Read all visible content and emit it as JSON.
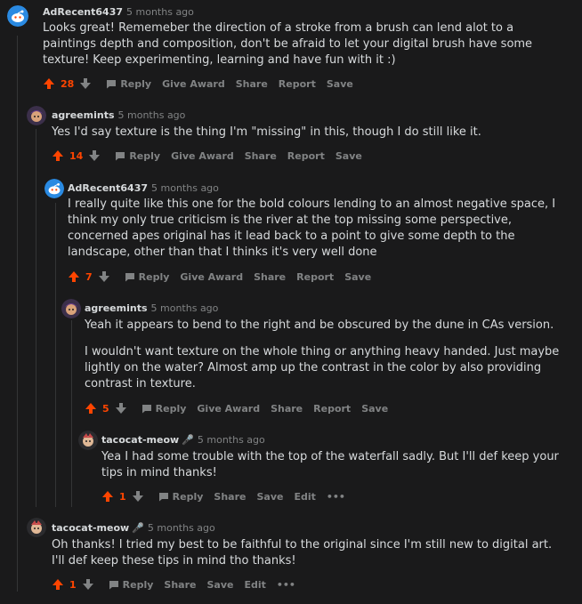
{
  "comments": [
    {
      "author": "AdRecent6437",
      "time": "5 months ago",
      "body": [
        "Looks great! Rememeber the direction of a stroke from a brush can lend alot to a paintings depth and composition, don't be afraid to let your digital brush have some texture! Keep experimenting, learning and have fun with it :)"
      ],
      "score": "28",
      "actions": [
        "Reply",
        "Give Award",
        "Share",
        "Report",
        "Save"
      ]
    },
    {
      "author": "agreemints",
      "time": "5 months ago",
      "body": [
        "Yes I'd say texture is the thing I'm \"missing\" in this, though I do still like it."
      ],
      "score": "14",
      "actions": [
        "Reply",
        "Give Award",
        "Share",
        "Report",
        "Save"
      ]
    },
    {
      "author": "AdRecent6437",
      "time": "5 months ago",
      "body": [
        "I really quite like this one for the bold colours lending to an almost negative space, I think my only true criticism is the river at the top missing some perspective, concerned apes original has it lead back to a point to give some depth to the landscape, other than that I thinks it's very well done"
      ],
      "score": "7",
      "actions": [
        "Reply",
        "Give Award",
        "Share",
        "Report",
        "Save"
      ]
    },
    {
      "author": "agreemints",
      "time": "5 months ago",
      "body": [
        "Yeah it appears to bend to the right and be obscured by the dune in CAs version.",
        "I wouldn't want texture on the whole thing or anything heavy handed. Just maybe lightly on the water? Almost amp up the contrast in the color by also providing contrast in texture."
      ],
      "score": "5",
      "actions": [
        "Reply",
        "Give Award",
        "Share",
        "Report",
        "Save"
      ]
    },
    {
      "author": "tacocat-meow",
      "time": "5 months ago",
      "body": [
        "Yea I had some trouble with the top of the waterfall sadly. But I'll def keep your tips in mind thanks!"
      ],
      "score": "1",
      "actions": [
        "Reply",
        "Share",
        "Save",
        "Edit",
        "•••"
      ]
    },
    {
      "author": "tacocat-meow",
      "time": "5 months ago",
      "body": [
        "Oh thanks! I tried my best to be faithful to the original since I'm still new to digital art. I'll def keep these tips in mind tho thanks!"
      ],
      "score": "1",
      "actions": [
        "Reply",
        "Share",
        "Save",
        "Edit",
        "•••"
      ]
    }
  ],
  "colors": {
    "background": "#1a1a1b",
    "upvote_active": "#ff4500",
    "muted": "#818384",
    "text": "#d7dadc",
    "snoo_blue": "#2a8ae2"
  },
  "icons": {
    "snoo_avatar": "snoo-avatar-icon",
    "custom_avatar": "user-avatar-icon",
    "upvote": "upvote-arrow-icon",
    "downvote": "downvote-arrow-icon",
    "reply": "comment-bubble-icon",
    "mic": "microphone-icon"
  }
}
